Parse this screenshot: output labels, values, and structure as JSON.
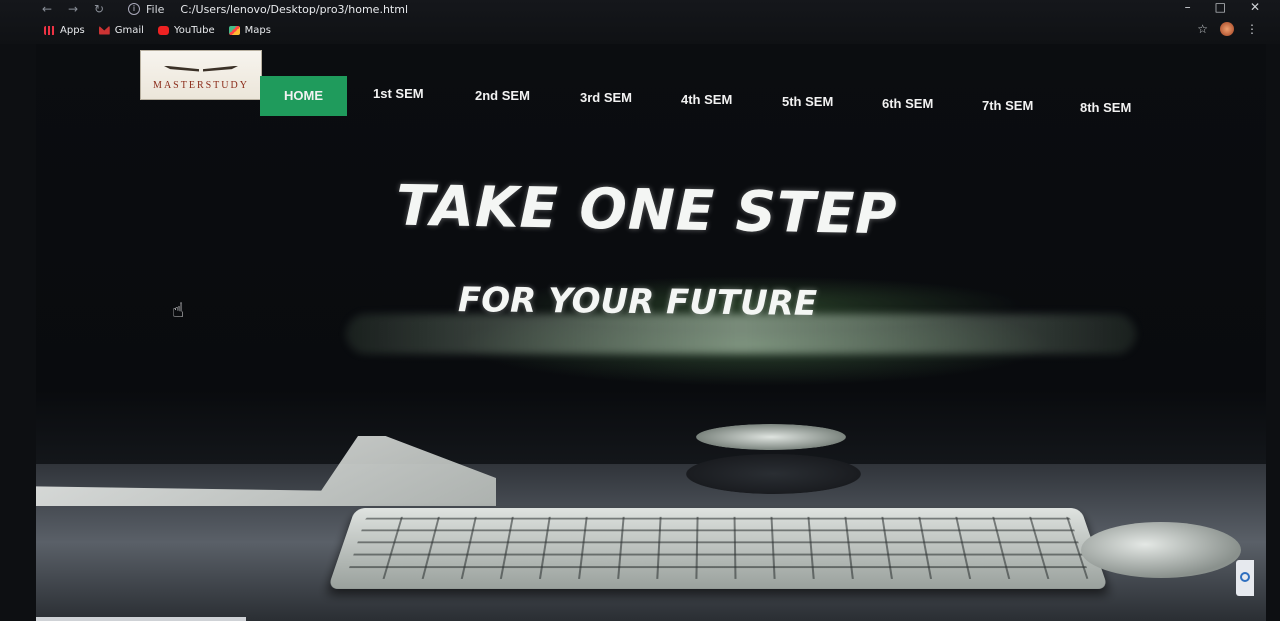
{
  "browser": {
    "url_label": "File",
    "url": "C:/Users/lenovo/Desktop/pro3/home.html",
    "bookmarks": [
      {
        "label": "Apps",
        "icon": "apps-icon"
      },
      {
        "label": "Gmail",
        "icon": "gmail-icon"
      },
      {
        "label": "YouTube",
        "icon": "youtube-icon"
      },
      {
        "label": "Maps",
        "icon": "maps-icon"
      }
    ]
  },
  "site": {
    "logo_text": "MASTERSTUDY",
    "nav": [
      {
        "label": "HOME",
        "active": true
      },
      {
        "label": "1st SEM"
      },
      {
        "label": "2nd SEM"
      },
      {
        "label": "3rd SEM"
      },
      {
        "label": "4th SEM"
      },
      {
        "label": "5th SEM"
      },
      {
        "label": "6th SEM"
      },
      {
        "label": "7th SEM"
      },
      {
        "label": "8th SEM"
      }
    ],
    "accent_color": "#1f9b5c"
  },
  "hero": {
    "headline": "TAKE ONE STEP",
    "subheadline": "FOR YOUR FUTURE"
  }
}
